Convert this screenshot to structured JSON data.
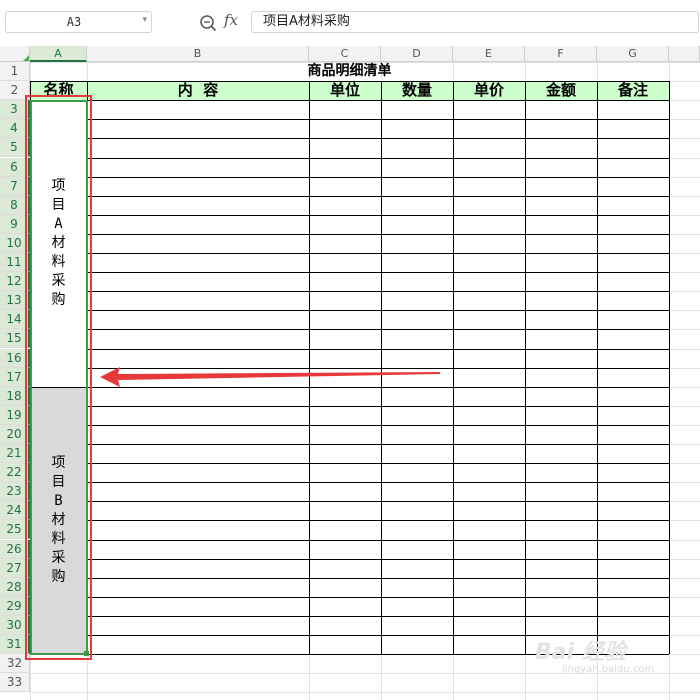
{
  "formula_bar": {
    "name_box": "A3",
    "fx_label": "fx",
    "formula": "项目A材料采购"
  },
  "columns": [
    "A",
    "B",
    "C",
    "D",
    "E",
    "F",
    "G"
  ],
  "selected_column": "A",
  "rows": [
    "1",
    "2",
    "3",
    "4",
    "5",
    "6",
    "7",
    "8",
    "9",
    "10",
    "11",
    "12",
    "13",
    "14",
    "15",
    "16",
    "17",
    "18",
    "19",
    "20",
    "21",
    "22",
    "23",
    "24",
    "25",
    "26",
    "27",
    "28",
    "29",
    "30",
    "31",
    "32",
    "33"
  ],
  "selected_rows": {
    "from": 3,
    "to": 31
  },
  "sheet": {
    "title": "商品明细清单",
    "headers": [
      "名称",
      "内  容",
      "单位",
      "数量",
      "单价",
      "金额",
      "备注"
    ],
    "merged_a": [
      {
        "text": "项目A材料采购",
        "fill": "#ffffff"
      },
      {
        "text": "项目B材料采购",
        "fill": "#d9d9d9"
      }
    ],
    "header_fill": "#ccffcc"
  },
  "colors": {
    "selection": "#3c9a4a",
    "annotation": "#e8393a"
  },
  "watermark": {
    "text": "Bai 经验",
    "sub": "jingyan.baidu.com"
  }
}
